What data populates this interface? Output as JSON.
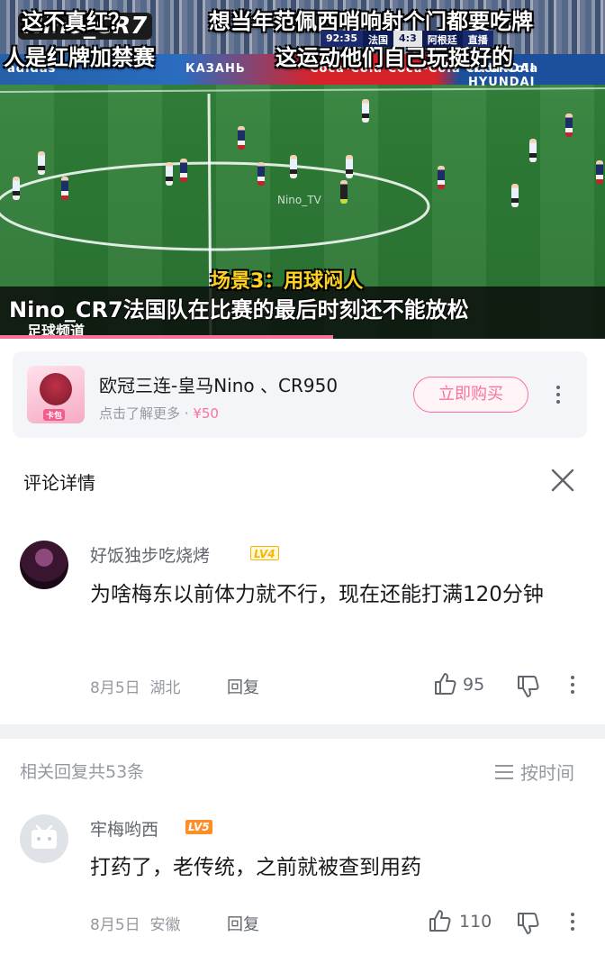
{
  "video": {
    "caption_top_left": "这不真红？",
    "caption_top_right": "想当年范佩西哨响射个门都要吃牌",
    "caption_second_left": "人是红牌加禁赛",
    "caption_second_right": "这运动他们自己玩挺好的",
    "logo_watermark": "Nino_CR7",
    "ad_board_1": "adidas",
    "ad_board_2": "КАЗАНЬ",
    "ad_board_3": "Coca-Cola  Coca-Cola  Coca-Cola",
    "ad_board_4": "HYUNDAI  HYUNDAI",
    "scorebug": {
      "time": "92:35",
      "team_home": "法国",
      "score": "4:3",
      "team_away": "阿根廷",
      "live": "直播"
    },
    "center_watermark": "Nino_TV",
    "scene_label": "场景3：用球闷人",
    "subtitle_prefix": "Nino_CR7",
    "subtitle_text": "法国队在比赛的最后时刻还不能放松",
    "channel_label": "足球频道",
    "progress": 0.55
  },
  "product": {
    "title": "欧冠三连-皇马Nino 、CR950",
    "subtitle": "点击了解更多 · ",
    "price": "¥50",
    "thumb_tag": "卡包",
    "buy_label": "立即购买",
    "more_icon": "more-vertical-icon"
  },
  "comment_detail": {
    "title": "评论详情",
    "close_icon": "close-icon"
  },
  "main_comment": {
    "username": "好饭独步吃烧烤",
    "level": "LV4",
    "text": "为啥梅东以前体力就不行，现在还能打满120分钟",
    "date": "8月5日",
    "location": "湖北",
    "reply_label": "回复",
    "likes": "95"
  },
  "replies": {
    "count_label": "相关回复共53条",
    "sort_label": "按时间",
    "items": [
      {
        "username": "牢梅哟西",
        "level": "LV5",
        "text": "打药了，老传统，之前就被查到用药",
        "date": "8月5日",
        "location": "安徽",
        "reply_label": "回复",
        "likes": "110"
      }
    ]
  },
  "colors": {
    "accent_pink": "#fb7299",
    "text_primary": "#18191c",
    "text_secondary": "#9499a0",
    "level4": "#f7b500",
    "level5": "#ff8e29"
  }
}
